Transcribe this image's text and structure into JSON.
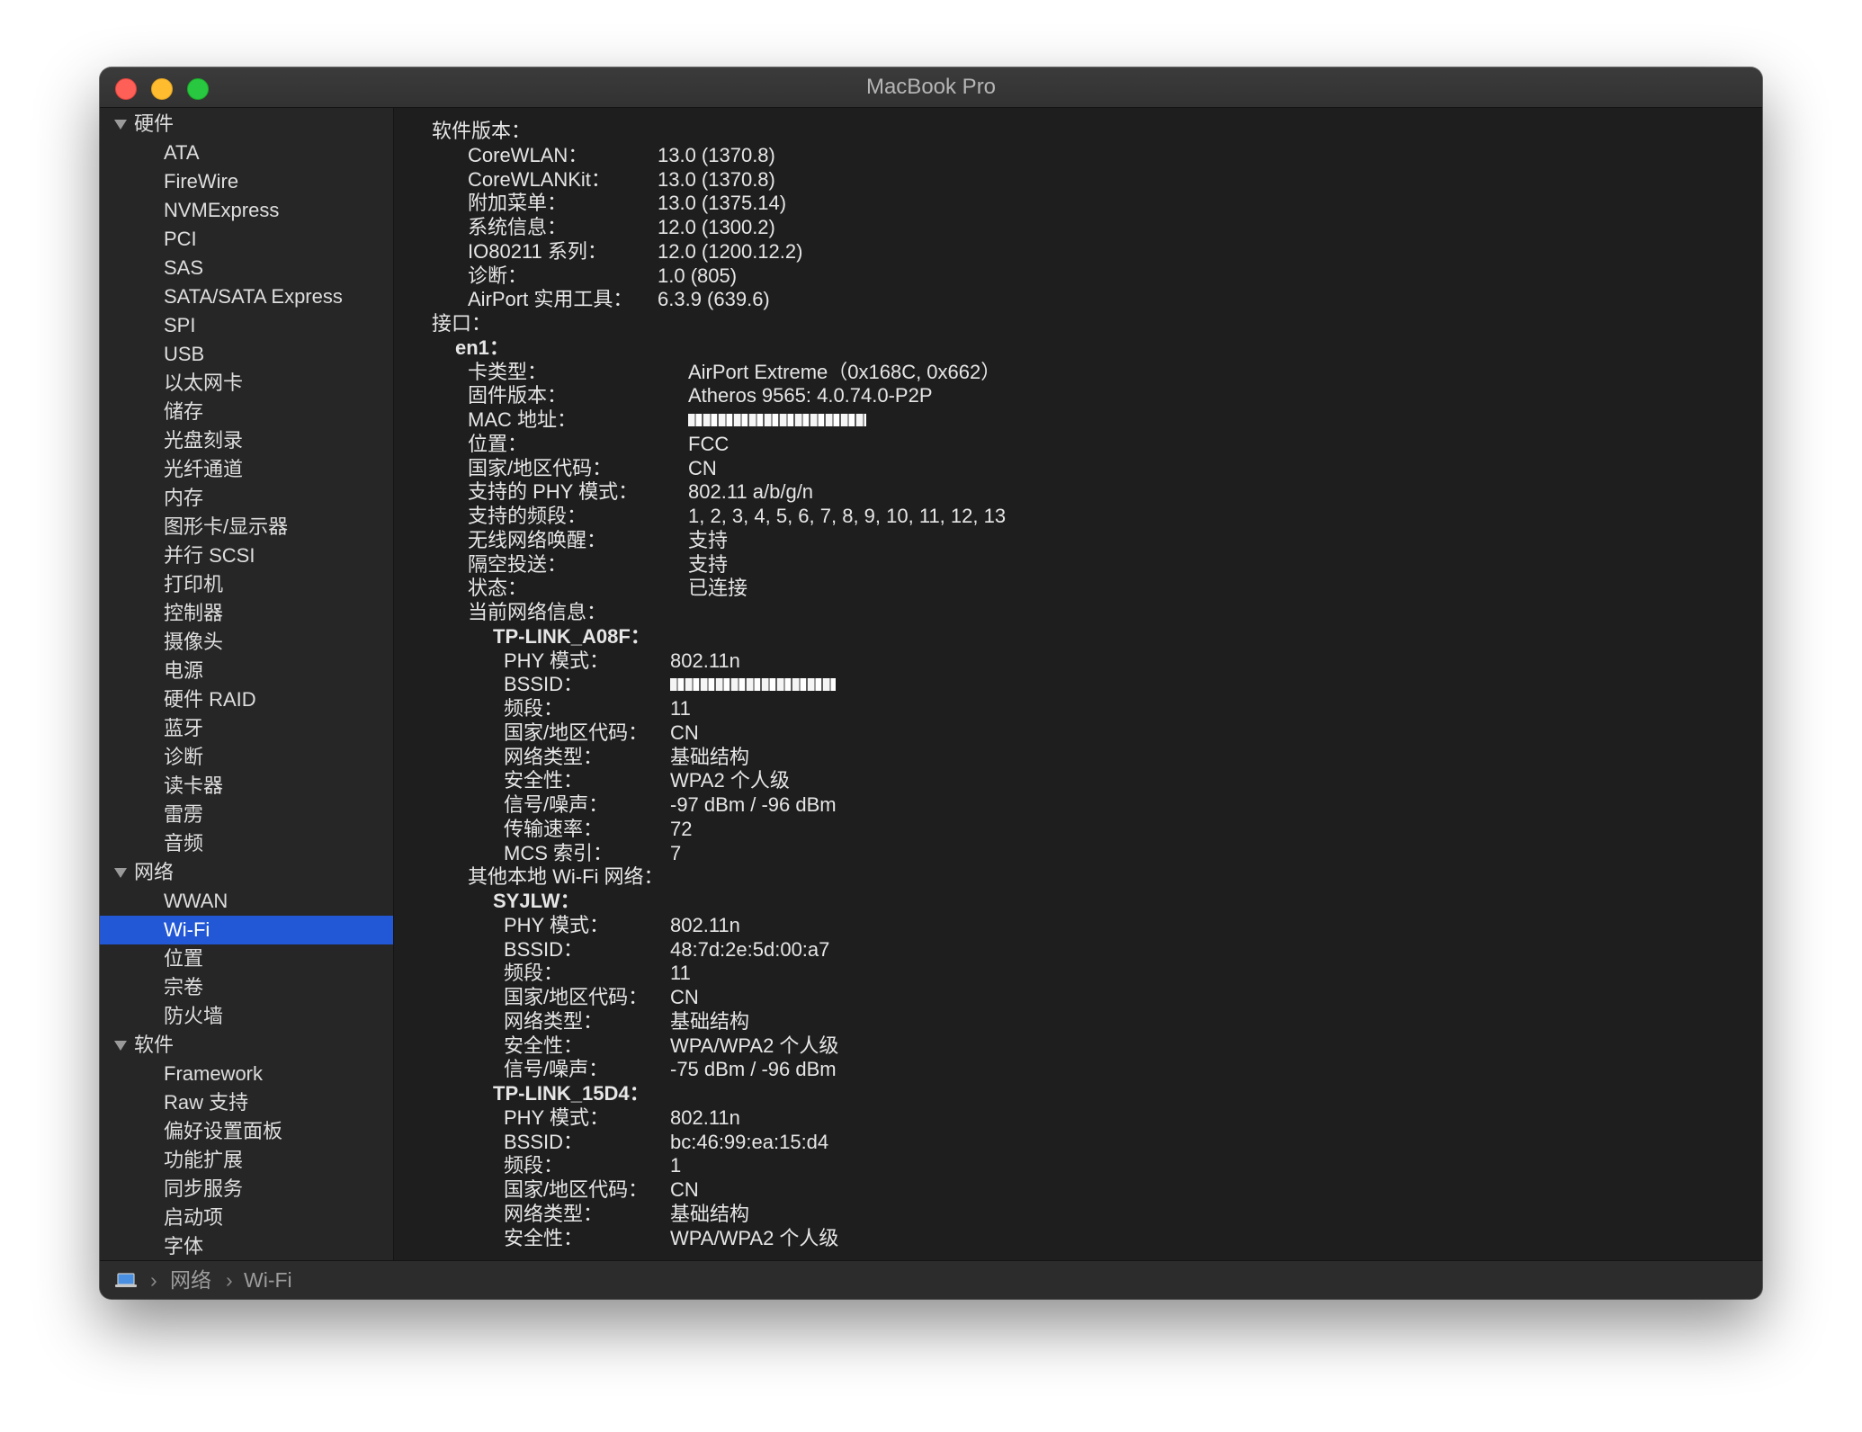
{
  "window": {
    "title": "MacBook Pro"
  },
  "sidebar": {
    "groups": [
      {
        "label": "硬件",
        "items": [
          "ATA",
          "FireWire",
          "NVMExpress",
          "PCI",
          "SAS",
          "SATA/SATA Express",
          "SPI",
          "USB",
          "以太网卡",
          "储存",
          "光盘刻录",
          "光纤通道",
          "内存",
          "图形卡/显示器",
          "并行 SCSI",
          "打印机",
          "控制器",
          "摄像头",
          "电源",
          "硬件 RAID",
          "蓝牙",
          "诊断",
          "读卡器",
          "雷雳",
          "音频"
        ]
      },
      {
        "label": "网络",
        "items": [
          "WWAN",
          "Wi-Fi",
          "位置",
          "宗卷",
          "防火墙"
        ]
      },
      {
        "label": "软件",
        "items": [
          "Framework",
          "Raw 支持",
          "偏好设置面板",
          "功能扩展",
          "同步服务",
          "启动项",
          "字体"
        ]
      }
    ],
    "selected": "Wi-Fi"
  },
  "content": {
    "lines": [
      {
        "k": "软件版本：",
        "v": "",
        "indent": 0,
        "bold": false
      },
      {
        "k": "CoreWLAN：",
        "v": "13.0 (1370.8)",
        "indent": 1,
        "bold": false
      },
      {
        "k": "CoreWLANKit：",
        "v": "13.0 (1370.8)",
        "indent": 1,
        "bold": false
      },
      {
        "k": "附加菜单：",
        "v": "13.0 (1375.14)",
        "indent": 1,
        "bold": false
      },
      {
        "k": "系统信息：",
        "v": "12.0 (1300.2)",
        "indent": 1,
        "bold": false
      },
      {
        "k": "IO80211 系列：",
        "v": "12.0 (1200.12.2)",
        "indent": 1,
        "bold": false
      },
      {
        "k": "诊断：",
        "v": "1.0 (805)",
        "indent": 1,
        "bold": false
      },
      {
        "k": "AirPort 实用工具：",
        "v": "6.3.9 (639.6)",
        "indent": 1,
        "bold": false
      },
      {
        "k": "接口：",
        "v": "",
        "indent": 0,
        "bold": false
      },
      {
        "k": "en1：",
        "v": "",
        "indent": 2,
        "bold": true
      },
      {
        "k": "卡类型：",
        "v": "AirPort Extreme（0x168C, 0x662）",
        "indent": 3,
        "bold": false
      },
      {
        "k": "固件版本：",
        "v": "Atheros 9565: 4.0.74.0-P2P",
        "indent": 3,
        "bold": false
      },
      {
        "k": "MAC 地址：",
        "v": "",
        "indent": 3,
        "bold": false,
        "redacted": true
      },
      {
        "k": "位置：",
        "v": "FCC",
        "indent": 3,
        "bold": false
      },
      {
        "k": "国家/地区代码：",
        "v": "CN",
        "indent": 3,
        "bold": false
      },
      {
        "k": "支持的 PHY 模式：",
        "v": "802.11 a/b/g/n",
        "indent": 3,
        "bold": false
      },
      {
        "k": "支持的频段：",
        "v": "1, 2, 3, 4, 5, 6, 7, 8, 9, 10, 11, 12, 13",
        "indent": 3,
        "bold": false
      },
      {
        "k": "无线网络唤醒：",
        "v": "支持",
        "indent": 3,
        "bold": false
      },
      {
        "k": "隔空投送：",
        "v": "支持",
        "indent": 3,
        "bold": false
      },
      {
        "k": "状态：",
        "v": "已连接",
        "indent": 3,
        "bold": false
      },
      {
        "k": "当前网络信息：",
        "v": "",
        "indent": 3,
        "bold": false
      },
      {
        "k": "TP-LINK_A08F：",
        "v": "",
        "indent": 4,
        "bold": true
      },
      {
        "k": "PHY 模式：",
        "v": "802.11n",
        "indent": 5,
        "bold": false
      },
      {
        "k": "BSSID：",
        "v": "",
        "indent": 5,
        "bold": false,
        "redacted": true
      },
      {
        "k": "频段：",
        "v": "11",
        "indent": 5,
        "bold": false
      },
      {
        "k": "国家/地区代码：",
        "v": "CN",
        "indent": 5,
        "bold": false
      },
      {
        "k": "网络类型：",
        "v": "基础结构",
        "indent": 5,
        "bold": false
      },
      {
        "k": "安全性：",
        "v": "WPA2 个人级",
        "indent": 5,
        "bold": false
      },
      {
        "k": "信号/噪声：",
        "v": "-97 dBm / -96 dBm",
        "indent": 5,
        "bold": false
      },
      {
        "k": "传输速率：",
        "v": "72",
        "indent": 5,
        "bold": false
      },
      {
        "k": "MCS 索引：",
        "v": "7",
        "indent": 5,
        "bold": false
      },
      {
        "k": "其他本地 Wi-Fi 网络：",
        "v": "",
        "indent": 3,
        "bold": false
      },
      {
        "k": "SYJLW：",
        "v": "",
        "indent": 4,
        "bold": true
      },
      {
        "k": "PHY 模式：",
        "v": "802.11n",
        "indent": 5,
        "bold": false
      },
      {
        "k": "BSSID：",
        "v": "48:7d:2e:5d:00:a7",
        "indent": 5,
        "bold": false
      },
      {
        "k": "频段：",
        "v": "11",
        "indent": 5,
        "bold": false
      },
      {
        "k": "国家/地区代码：",
        "v": "CN",
        "indent": 5,
        "bold": false
      },
      {
        "k": "网络类型：",
        "v": "基础结构",
        "indent": 5,
        "bold": false
      },
      {
        "k": "安全性：",
        "v": "WPA/WPA2 个人级",
        "indent": 5,
        "bold": false
      },
      {
        "k": "信号/噪声：",
        "v": "-75 dBm / -96 dBm",
        "indent": 5,
        "bold": false
      },
      {
        "k": "TP-LINK_15D4：",
        "v": "",
        "indent": 4,
        "bold": true
      },
      {
        "k": "PHY 模式：",
        "v": "802.11n",
        "indent": 5,
        "bold": false
      },
      {
        "k": "BSSID：",
        "v": "bc:46:99:ea:15:d4",
        "indent": 5,
        "bold": false
      },
      {
        "k": "频段：",
        "v": "1",
        "indent": 5,
        "bold": false
      },
      {
        "k": "国家/地区代码：",
        "v": "CN",
        "indent": 5,
        "bold": false
      },
      {
        "k": "网络类型：",
        "v": "基础结构",
        "indent": 5,
        "bold": false
      },
      {
        "k": "安全性：",
        "v": "WPA/WPA2 个人级",
        "indent": 5,
        "bold": false
      }
    ]
  },
  "statusbar": {
    "crumbs": [
      "网络",
      "Wi-Fi"
    ],
    "separator": "›",
    "icon": "laptop-icon"
  },
  "colors": {
    "selection": "#2257d6",
    "close": "#fe5f57",
    "minimize": "#febc2e",
    "maximize": "#28c840"
  }
}
